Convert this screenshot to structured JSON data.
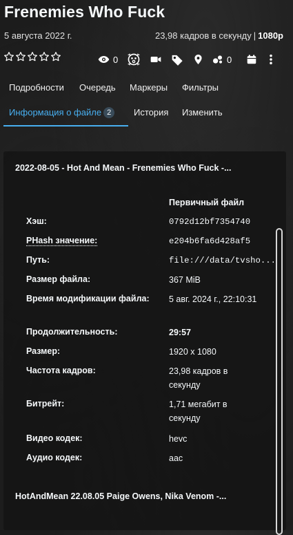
{
  "header": {
    "title": "Frenemies Who Fuck",
    "date": "5 августа 2022 г.",
    "framerate": "23,98 кадров в секунду",
    "separator": "|",
    "resolution": "1080p"
  },
  "rating": {
    "stars_total": 5,
    "stars_filled": 0
  },
  "toolbar": {
    "play_count": "0",
    "o_count": "0"
  },
  "tabs_row1": [
    "Подробности",
    "Очередь",
    "Маркеры",
    "Фильтры"
  ],
  "tabs_row2": {
    "file_info": "Информация о файле",
    "file_info_count": "2",
    "history": "История",
    "edit": "Изменить"
  },
  "file_card": {
    "file_name": "2022-08-05 - Hot And Mean - Frenemies Who Fuck -...",
    "column_header": "Первичный файл",
    "rows": [
      {
        "label": "Хэш:",
        "value": "0792d12bf7354740"
      },
      {
        "label": "PHash значение:",
        "value": "e204b6fa6d428af5"
      },
      {
        "label": "Путь:",
        "value": "file:///data/tvsho..."
      },
      {
        "label": "Размер файла:",
        "value": "367 MiB"
      },
      {
        "label": "Время модификации файла:",
        "value": "5 авг. 2024 г., 22:10:31"
      },
      {
        "label": "Продолжительность:",
        "value": "29:57"
      },
      {
        "label": "Размер:",
        "value": "1920 x 1080"
      },
      {
        "label": "Частота кадров:",
        "value": "23,98 кадров в секунду"
      },
      {
        "label": "Битрейт:",
        "value": "1,71 мегабит в секунду"
      },
      {
        "label": "Видео кодек:",
        "value": "hevc"
      },
      {
        "label": "Аудио кодек:",
        "value": "aac"
      }
    ],
    "second_file_name": "HotAndMean 22.08.05 Paige Owens, Nika Venom -..."
  },
  "colors": {
    "accent": "#48aff0",
    "badge_bg": "#394b59",
    "text": "#f5f8fa"
  }
}
